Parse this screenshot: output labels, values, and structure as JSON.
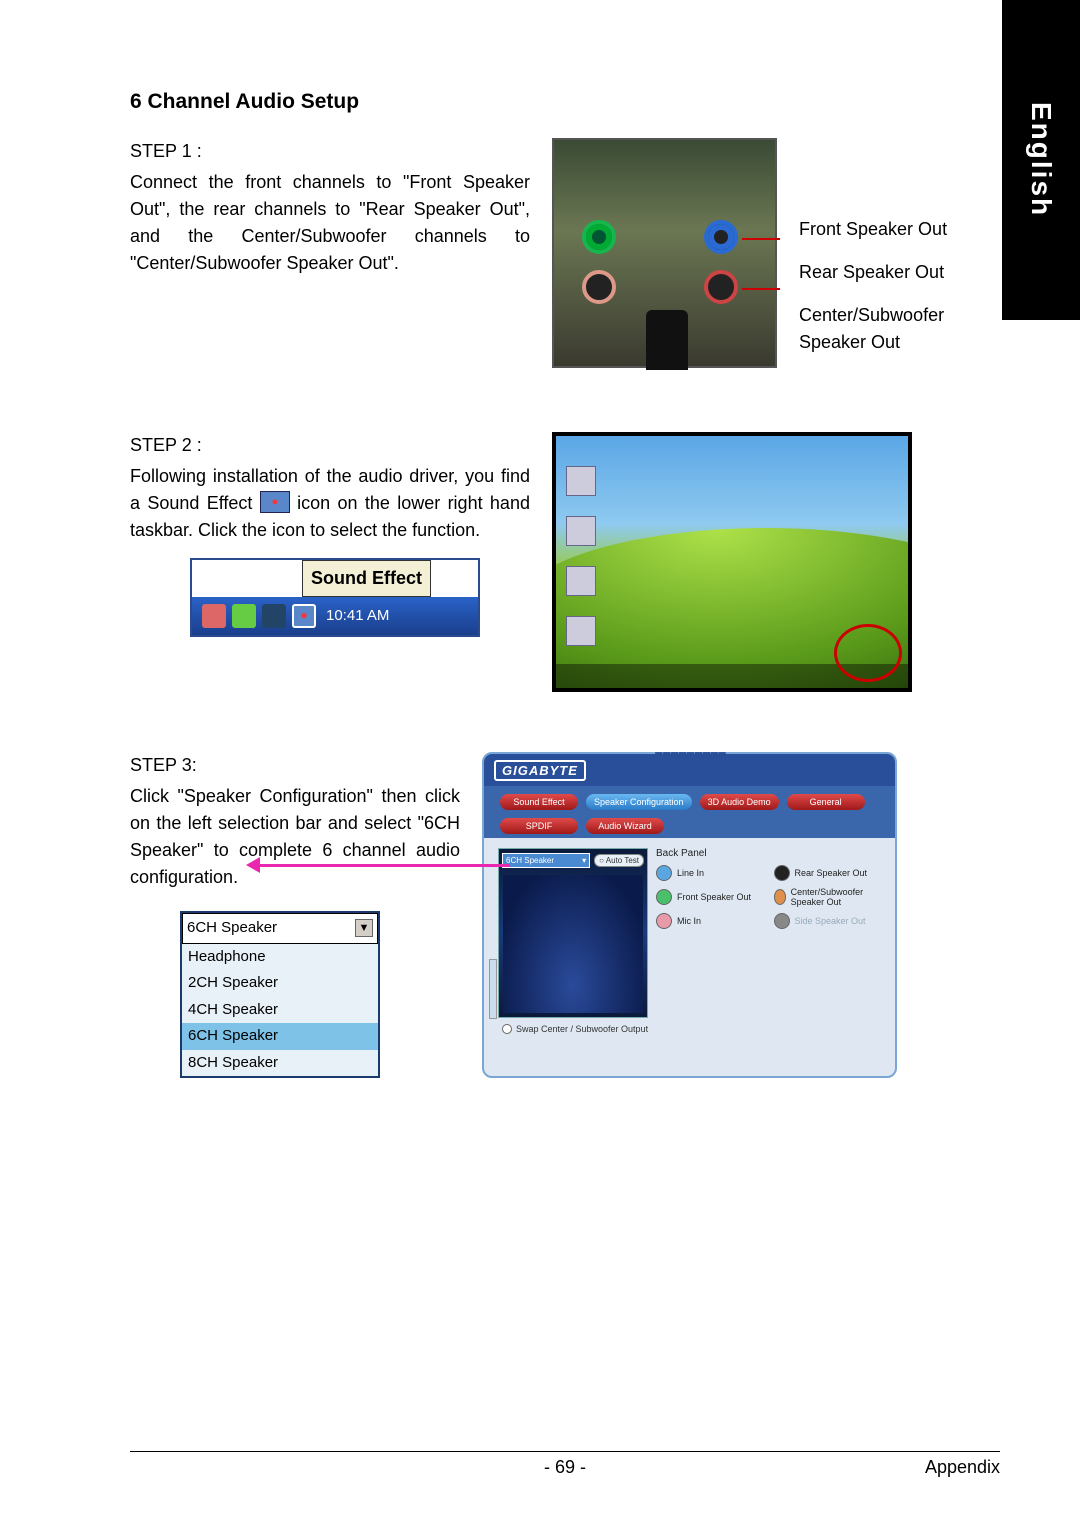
{
  "side_tab": "English",
  "title": "6 Channel Audio Setup",
  "step1": {
    "label": "STEP 1 :",
    "body": "Connect the front channels to \"Front Speaker Out\", the rear channels to \"Rear Speaker Out\", and the Center/Subwoofer channels to \"Center/Subwoofer Speaker Out\"."
  },
  "fig1_labels": {
    "front": "Front Speaker Out",
    "rear": "Rear Speaker Out",
    "center": "Center/Subwoofer Speaker Out"
  },
  "step2": {
    "label": "STEP 2 :",
    "body_a": "Following installation of the audio driver, you find a Sound Effect ",
    "body_b": " icon on the lower right hand taskbar. Click the icon to select the function."
  },
  "taskbar": {
    "tooltip": "Sound Effect",
    "clock": "10:41 AM"
  },
  "step3": {
    "label": "STEP 3:",
    "body": "Click \"Speaker Configuration\" then click on the left selection bar and select \"6CH Speaker\" to complete 6 channel audio configuration."
  },
  "dropdown": {
    "selected": "6CH Speaker",
    "options": [
      "Headphone",
      "2CH Speaker",
      "4CH Speaker",
      "6CH Speaker",
      "8CH Speaker"
    ]
  },
  "gb_window": {
    "logo": "GIGABYTE",
    "tabs": [
      "Sound Effect",
      "Speaker Configuration",
      "3D Audio Demo",
      "General",
      "SPDIF",
      "Audio Wizard"
    ],
    "mini_dd": "6CH Speaker",
    "auto_test": "Auto Test",
    "back_panel": "Back Panel",
    "ports": {
      "line_in": "Line In",
      "rear": "Rear Speaker Out",
      "front": "Front Speaker Out",
      "center": "Center/Subwoofer Speaker Out",
      "mic": "Mic In",
      "side": "Side Speaker Out"
    },
    "footer": "Swap Center / Subwoofer Output"
  },
  "footer": {
    "page": "- 69 -",
    "section": "Appendix"
  }
}
